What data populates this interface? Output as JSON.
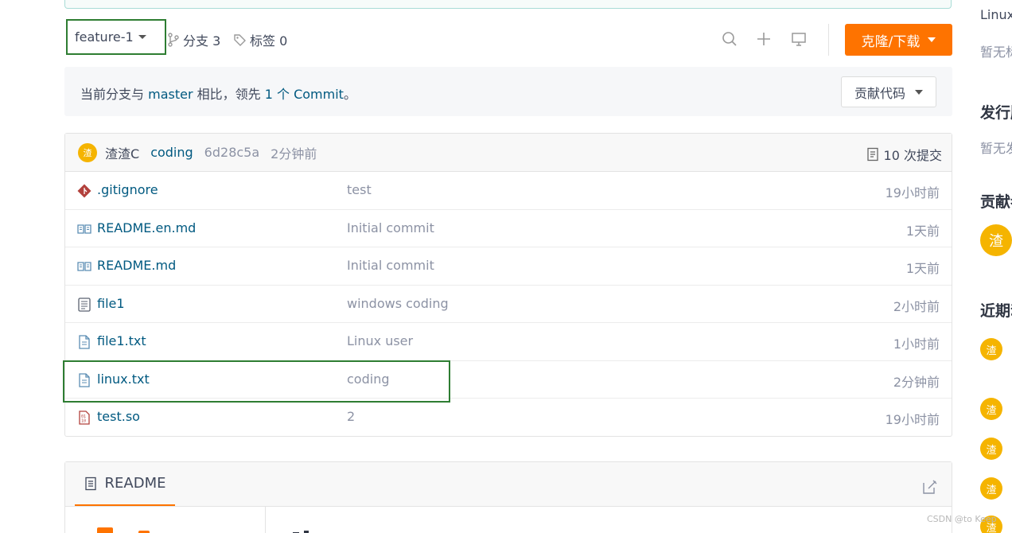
{
  "branch_bar": {
    "branch_name": "feature-1",
    "branches_label": "分支 3",
    "tags_label": "标签 0",
    "clone_label": "克隆/下载"
  },
  "compare": {
    "prefix": "当前分支与",
    "branch": "master",
    "middle": "相比，领先",
    "count": "1 个 Commit",
    "suffix": "。",
    "contribute_label": "贡献代码"
  },
  "latest_commit": {
    "avatar_char": "渣",
    "author": "渣渣C",
    "message": "coding",
    "hash": "6d28c5a",
    "time": "2分钟前",
    "count_label": "10 次提交"
  },
  "files": [
    {
      "icon": "gitignore-icon",
      "name": ".gitignore",
      "commit": "test",
      "time": "19小时前"
    },
    {
      "icon": "book-icon",
      "name": "README.en.md",
      "commit": "Initial commit",
      "time": "1天前"
    },
    {
      "icon": "book-icon",
      "name": "README.md",
      "commit": "Initial commit",
      "time": "1天前"
    },
    {
      "icon": "text-file-icon",
      "name": "file1",
      "commit": "windows coding",
      "time": "2小时前"
    },
    {
      "icon": "file-icon",
      "name": "file1.txt",
      "commit": "Linux user",
      "time": "1小时前"
    },
    {
      "icon": "file-icon",
      "name": "linux.txt",
      "commit": "coding",
      "time": "2分钟前"
    },
    {
      "icon": "binary-file-icon",
      "name": "test.so",
      "commit": "2",
      "time": "19小时前"
    }
  ],
  "readme": {
    "tab_label": "README"
  },
  "sidebar": {
    "lang": "Linux",
    "desc_empty": "暂无标签",
    "release_heading": "发行版",
    "release_empty": "暂无发行版",
    "contrib_heading": "贡献者",
    "contrib_avatar": "渣",
    "recent_heading": "近期动态",
    "recent_avatar": "渣"
  },
  "watermark": "CSDN @to Keep",
  "colors": {
    "accent": "#fe7300",
    "link": "#005980",
    "highlight_border": "#2e7d32",
    "avatar": "#f5b400"
  }
}
